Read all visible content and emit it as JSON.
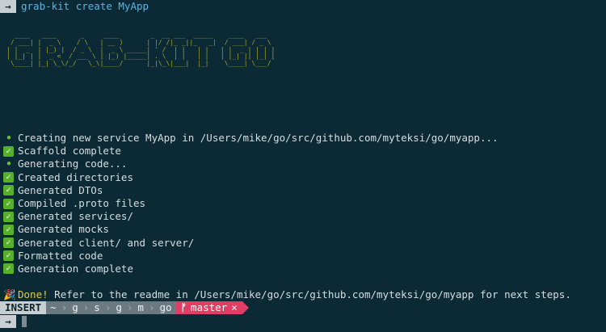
{
  "terminal": {
    "prompt_arrow": "→",
    "command": "grab-kit create MyApp",
    "banner_lines": [
      "  ____   ____      _     ____        _  __ ___  _____    ____   ___  ",
      " / ___| |  _ \\    / \\   | __ )      | |/ /|_ _||_   _|  / ___| / _ \\ ",
      "| |  _  | |_) |  / _ \\  |  _ \\ _____| ' /  | |   | |   | |  _ | | | |",
      "| |_| | |  _ <  / ___ \\ | |_) |_____| . \\  | |   | |   | |_| || |_| |",
      " \\____| |_| \\_\\/_/   \\_\\|____/      |_|\\_\\|___|  |_|    \\____| \\___/ "
    ],
    "log": [
      {
        "icon": "bullet",
        "text": "Creating new service MyApp in /Users/mike/go/src/github.com/myteksi/go/myapp..."
      },
      {
        "icon": "check",
        "text": "Scaffold complete"
      },
      {
        "icon": "bullet",
        "text": "Generating code..."
      },
      {
        "icon": "check",
        "text": "Created directories"
      },
      {
        "icon": "check",
        "text": "Generated DTOs"
      },
      {
        "icon": "check",
        "text": "Compiled .proto files"
      },
      {
        "icon": "check",
        "text": "Generated services/"
      },
      {
        "icon": "check",
        "text": "Generated mocks"
      },
      {
        "icon": "check",
        "text": "Generated client/ and server/"
      },
      {
        "icon": "check",
        "text": "Formatted code"
      },
      {
        "icon": "check",
        "text": "Generation complete"
      }
    ],
    "done": {
      "icon": "party-popper-icon",
      "label": "Done!",
      "text": "Refer to the readme in /Users/mike/go/src/github.com/myteksi/go/myapp for next steps."
    },
    "statusbar": {
      "mode": "INSERT",
      "path_segments": [
        "~",
        "g",
        "s",
        "g",
        "m",
        "go"
      ],
      "branch_symbol": "ᚠ",
      "branch": "master",
      "dirty": "×"
    },
    "colors": {
      "background": "#0b2a35",
      "command": "#5fb4e0",
      "banner": "#a9a52a",
      "check": "#56b02a",
      "git_segment": "#e03e64",
      "path_segment": "#6a7a80"
    }
  }
}
